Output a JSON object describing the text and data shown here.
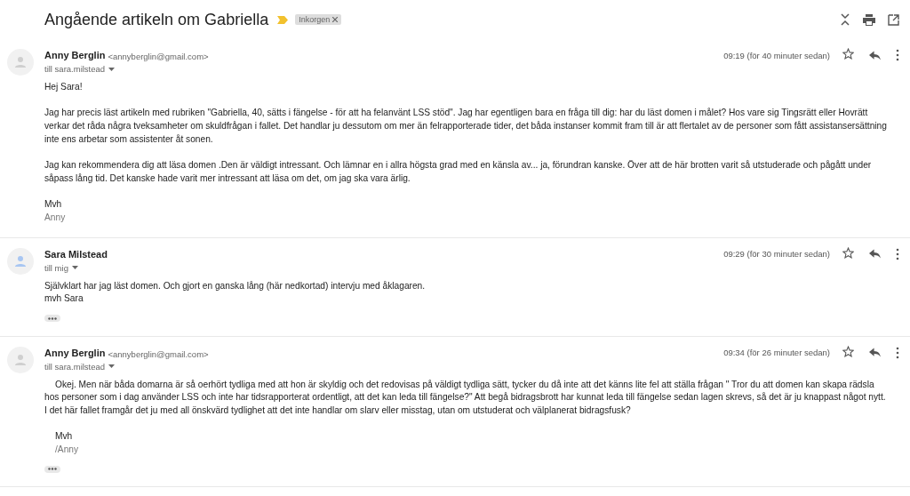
{
  "subject": "Angående artikeln om Gabriella",
  "important": true,
  "label": {
    "text": "Inkorgen",
    "removable": true
  },
  "messages": [
    {
      "sender": "Anny Berglin",
      "email": "<annyberglin@gmail.com>",
      "recipient": "till sara.milstead",
      "time": "09:19 (för 40 minuter sedan)",
      "starred": false,
      "indented": false,
      "trimmed": false,
      "paragraphs": [
        {
          "kind": "p",
          "text": "Hej Sara!"
        },
        {
          "kind": "p",
          "text": "Jag har precis läst artikeln med rubriken \"Gabriella, 40, sätts i fängelse - för att ha felanvänt LSS stöd\". Jag har egentligen bara en fråga till dig: har du läst domen i målet? Hos vare sig Tingsrätt eller Hovrätt verkar det råda några tveksamheter om skuldfrågan i fallet. Det handlar ju dessutom om mer än felrapporterade tider, det båda instanser kommit fram till är att flertalet av de personer som fått assistansersättning inte ens arbetar som assistenter åt sonen."
        },
        {
          "kind": "p",
          "text": "Jag kan rekommendera dig att läsa domen .Den är väldigt intressant. Och lämnar en i allra högsta grad med en känsla av... ja, förundran kanske. Över att de här brotten varit så utstuderade och pågått under såpass lång tid. Det kanske hade varit mer intressant att läsa om det, om jag ska vara ärlig."
        },
        {
          "kind": "line",
          "text": "Mvh"
        },
        {
          "kind": "muted",
          "text": "Anny"
        }
      ]
    },
    {
      "sender": "Sara Milstead",
      "recipient": "till mig",
      "time": "09:29 (för 30 minuter sedan)",
      "starred": false,
      "indented": false,
      "trimmed": true,
      "paragraphs": [
        {
          "kind": "line",
          "text": "Självklart har jag läst domen. Och gjort en ganska lång (här nedkortad) intervju med åklagaren."
        },
        {
          "kind": "line",
          "text": "mvh Sara"
        }
      ]
    },
    {
      "sender": "Anny Berglin",
      "email": "<annyberglin@gmail.com>",
      "recipient": "till sara.milstead",
      "time": "09:34 (för 26 minuter sedan)",
      "starred": false,
      "indented": true,
      "trimmed": true,
      "paragraphs": [
        {
          "kind": "p",
          "text": "Okej. Men när båda domarna är så oerhört tydliga med att hon är skyldig och det redovisas på väldigt tydliga sätt, tycker du då inte att det känns lite fel att ställa frågan \" Tror du att domen kan skapa rädsla hos personer som i dag använder LSS och inte har tidsrapporterat ordentligt, att det kan leda till fängelse?\" Att begå bidragsbrott har kunnat leda till fängelse sedan lagen skrevs, så det är ju knappast något nytt. I det här fallet framgår det ju med all önskvärd tydlighet att det inte handlar om slarv eller misstag, utan om utstuderat och välplanerat bidragsfusk?"
        },
        {
          "kind": "line",
          "text": "Mvh"
        },
        {
          "kind": "muted",
          "text": "/Anny"
        }
      ]
    }
  ]
}
